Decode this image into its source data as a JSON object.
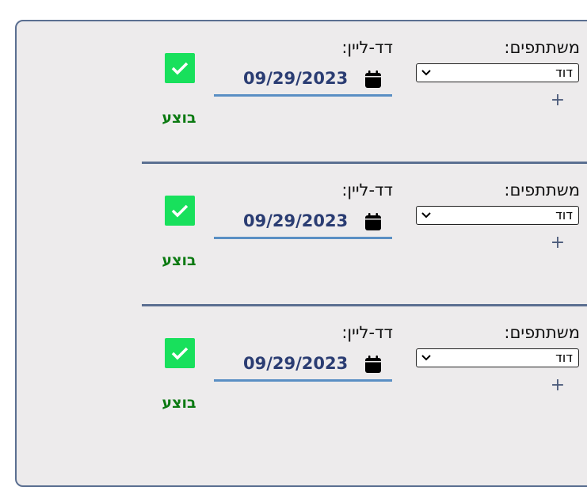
{
  "tasks": [
    {
      "participants_label": "משתתפים:",
      "participant": "דוד",
      "deadline_label": "דד-ליין:",
      "date": "09/29/2023",
      "completed": true,
      "status_label": "בוצע"
    },
    {
      "participants_label": "משתתפים:",
      "participant": "דוד",
      "deadline_label": "דד-ליין:",
      "date": "09/29/2023",
      "completed": true,
      "status_label": "בוצע"
    },
    {
      "participants_label": "משתתפים:",
      "participant": "דוד",
      "deadline_label": "דד-ליין:",
      "date": "09/29/2023",
      "completed": true,
      "status_label": "בוצע"
    }
  ],
  "icons": {
    "add": "plus-icon",
    "calendar": "calendar-icon",
    "dropdown": "chevron-down-icon",
    "check": "check-icon"
  },
  "colors": {
    "panel_background": "#edebec",
    "border": "#5b6f91",
    "checkbox": "#18e05c",
    "status_text": "#0c7a12",
    "date_text": "#2b3d73",
    "underline": "#5a8fc4"
  }
}
